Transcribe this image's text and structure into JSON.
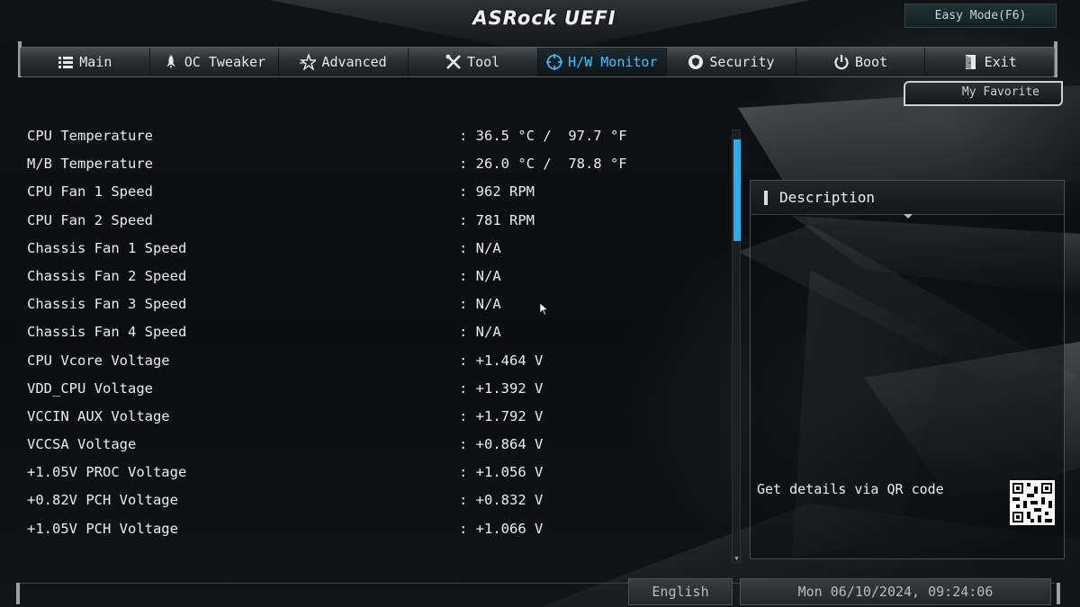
{
  "header": {
    "logo_text": "ASRock UEFI",
    "easy_mode_label": "Easy Mode(F6)",
    "my_favorite_label": "My Favorite"
  },
  "nav": {
    "tabs": [
      {
        "label": "Main",
        "icon": "list-icon",
        "active": false
      },
      {
        "label": "OC Tweaker",
        "icon": "rocket-icon",
        "active": false
      },
      {
        "label": "Advanced",
        "icon": "star-icon",
        "active": false
      },
      {
        "label": "Tool",
        "icon": "wrench-icon",
        "active": false
      },
      {
        "label": "H/W Monitor",
        "icon": "monitor-target-icon",
        "active": true
      },
      {
        "label": "Security",
        "icon": "shield-icon",
        "active": false
      },
      {
        "label": "Boot",
        "icon": "power-icon",
        "active": false
      },
      {
        "label": "Exit",
        "icon": "exit-icon",
        "active": false
      }
    ],
    "active_color": "#39c3ff"
  },
  "monitor": {
    "rows": [
      {
        "label": "CPU Temperature",
        "value": ": 36.5 °C /  97.7 °F"
      },
      {
        "label": "M/B Temperature",
        "value": ": 26.0 °C /  78.8 °F"
      },
      {
        "label": "CPU Fan 1 Speed",
        "value": ": 962 RPM"
      },
      {
        "label": "CPU Fan 2 Speed",
        "value": ": 781 RPM"
      },
      {
        "label": "Chassis Fan 1 Speed",
        "value": ": N/A"
      },
      {
        "label": "Chassis Fan 2 Speed",
        "value": ": N/A"
      },
      {
        "label": "Chassis Fan 3 Speed",
        "value": ": N/A"
      },
      {
        "label": "Chassis Fan 4 Speed",
        "value": ": N/A"
      },
      {
        "label": "CPU Vcore Voltage",
        "value": ": +1.464 V"
      },
      {
        "label": "VDD_CPU Voltage",
        "value": ": +1.392 V"
      },
      {
        "label": "VCCIN AUX Voltage",
        "value": ": +1.792 V"
      },
      {
        "label": "VCCSA Voltage",
        "value": ": +0.864 V"
      },
      {
        "label": "+1.05V PROC Voltage",
        "value": ": +1.056 V"
      },
      {
        "label": "+0.82V PCH Voltage",
        "value": ": +0.832 V"
      },
      {
        "label": "+1.05V PCH Voltage",
        "value": ": +1.066 V"
      }
    ],
    "scrollbar_color": "#29aee8"
  },
  "description": {
    "title": "Description",
    "qr_text": "Get details via QR code"
  },
  "footer": {
    "language": "English",
    "datetime": "Mon 06/10/2024, 09:24:06"
  }
}
